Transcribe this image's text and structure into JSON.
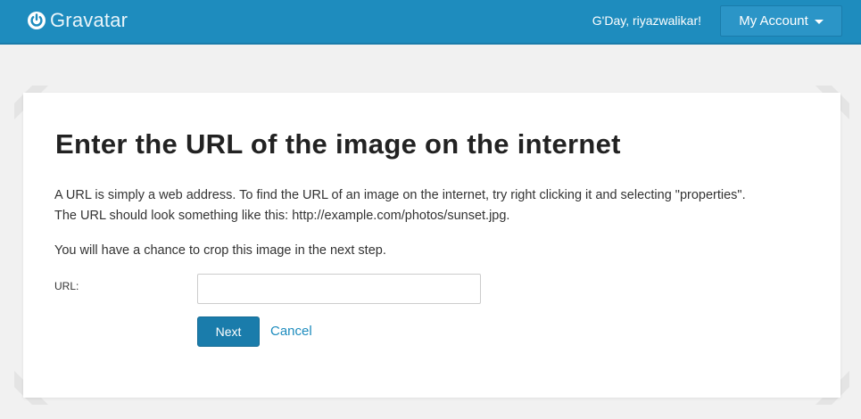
{
  "header": {
    "logo_text": "Gravatar",
    "logo_icon": "gravatar-power-icon",
    "greeting": "G'Day, riyazwalikar!",
    "account_button": "My Account",
    "colors": {
      "bar": "#1e8cbe",
      "button": "#2b95c7"
    }
  },
  "main": {
    "title": "Enter the URL of the image on the internet",
    "description_line1": "A URL is simply a web address. To find the URL of an image on the internet, try right clicking it and selecting \"properties\".",
    "description_line2": "The URL should look something like this: http://example.com/photos/sunset.jpg.",
    "note": "You will have a chance to crop this image in the next step.",
    "url_label": "URL:",
    "url_value": "",
    "next_button": "Next",
    "cancel_link": "Cancel"
  }
}
